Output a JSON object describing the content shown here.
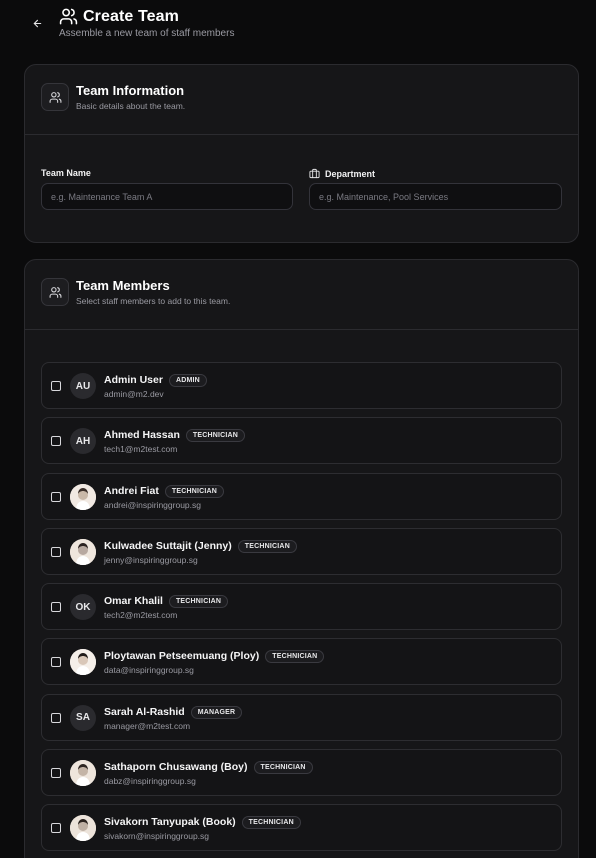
{
  "header": {
    "title": "Create Team",
    "subtitle": "Assemble a new team of staff members"
  },
  "team_info": {
    "title": "Team Information",
    "description": "Basic details about the team.",
    "team_name_label": "Team Name",
    "team_name_placeholder": "e.g. Maintenance Team A",
    "team_name_value": "",
    "department_label": "Department",
    "department_placeholder": "e.g. Maintenance, Pool Services",
    "department_value": ""
  },
  "team_members": {
    "title": "Team Members",
    "description": "Select staff members to add to this team.",
    "members": [
      {
        "name": "Admin User",
        "role": "ADMIN",
        "email": "admin@m2.dev",
        "initials": "AU",
        "avatar": "initials",
        "checked": false
      },
      {
        "name": "Ahmed Hassan",
        "role": "TECHNICIAN",
        "email": "tech1@m2test.com",
        "initials": "AH",
        "avatar": "initials",
        "checked": false
      },
      {
        "name": "Andrei Fiat",
        "role": "TECHNICIAN",
        "email": "andrei@inspiringgroup.sg",
        "initials": "",
        "avatar": "photo",
        "checked": false
      },
      {
        "name": "Kulwadee Suttajit (Jenny)",
        "role": "TECHNICIAN",
        "email": "jenny@inspiringgroup.sg",
        "initials": "",
        "avatar": "photo",
        "checked": false
      },
      {
        "name": "Omar Khalil",
        "role": "TECHNICIAN",
        "email": "tech2@m2test.com",
        "initials": "OK",
        "avatar": "initials",
        "checked": false
      },
      {
        "name": "Ploytawan Petseemuang (Ploy)",
        "role": "TECHNICIAN",
        "email": "data@inspiringgroup.sg",
        "initials": "",
        "avatar": "photo",
        "checked": false
      },
      {
        "name": "Sarah Al-Rashid",
        "role": "MANAGER",
        "email": "manager@m2test.com",
        "initials": "SA",
        "avatar": "initials",
        "checked": false
      },
      {
        "name": "Sathaporn Chusawang (Boy)",
        "role": "TECHNICIAN",
        "email": "dabz@inspiringgroup.sg",
        "initials": "",
        "avatar": "photo",
        "checked": false
      },
      {
        "name": "Sivakorn Tanyupak (Book)",
        "role": "TECHNICIAN",
        "email": "sivakorn@inspiringgroup.sg",
        "initials": "",
        "avatar": "photo",
        "checked": false
      }
    ]
  },
  "icons": {
    "back": "arrow-left-icon",
    "team": "users-icon",
    "department": "briefcase-icon"
  },
  "colors": {
    "background": "#0b0b0c",
    "card": "#161618",
    "border": "#2b2b2f",
    "text": "#f2f2f3",
    "muted": "#9a9aa2"
  }
}
